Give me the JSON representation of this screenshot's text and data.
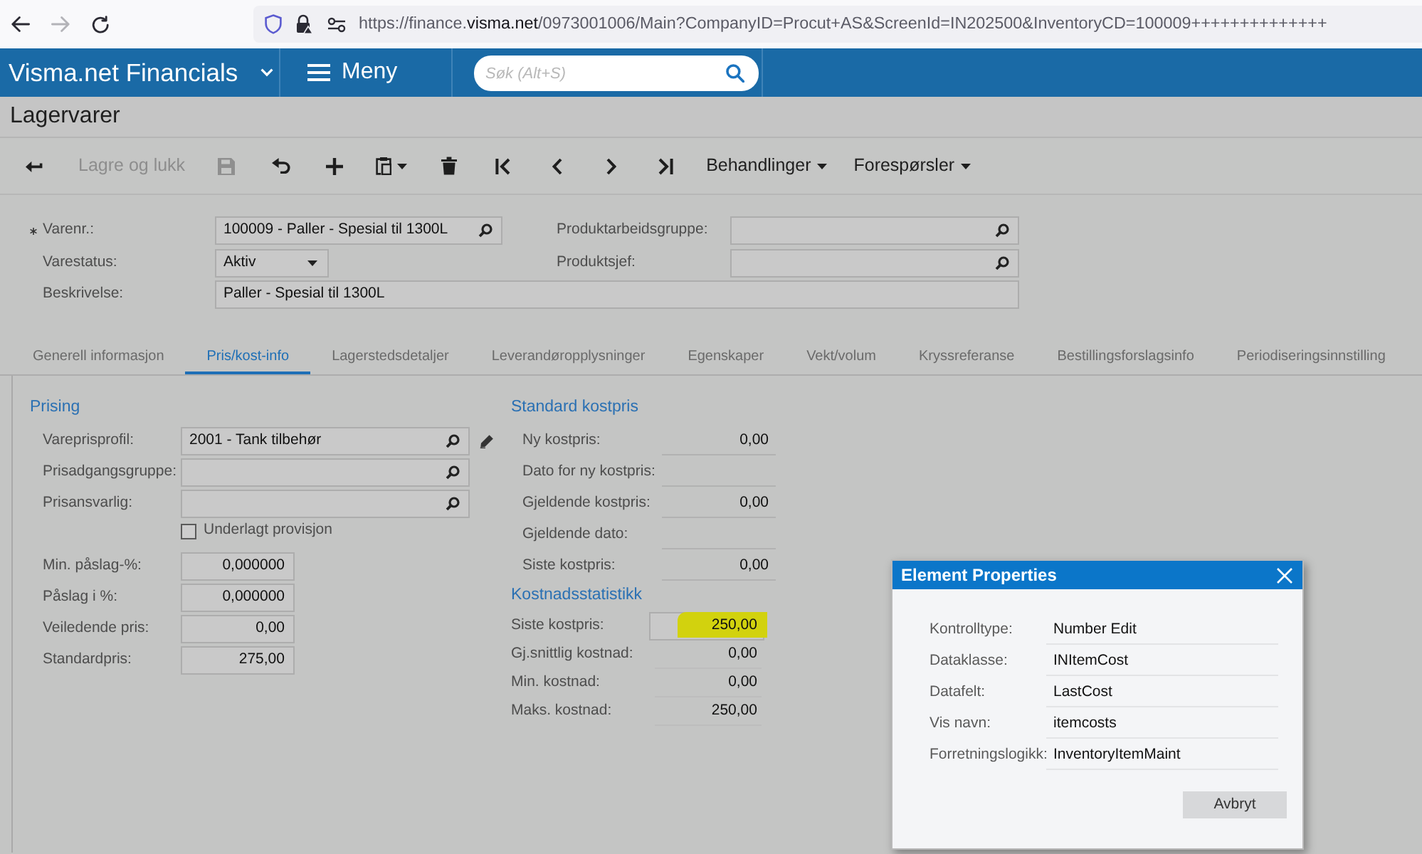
{
  "browser": {
    "nav": [
      {
        "kind": "back",
        "disabled": false
      },
      {
        "kind": "forward",
        "disabled": true
      },
      {
        "kind": "reload",
        "disabled": false
      }
    ],
    "url_prefix": "https://finance.",
    "url_domain": "visma.net",
    "url_rest": "/0973001006/Main?CompanyID=Procut+AS&ScreenId=IN202500&InventoryCD=100009++++++++++++++"
  },
  "app_header": {
    "product": "Visma.net Financials",
    "menu_label": "Meny",
    "search": {
      "placeholder": "Søk (Alt+S)"
    }
  },
  "page_title": "Lagervarer",
  "toolbar": [
    {
      "kind": "back",
      "disabled": false
    },
    {
      "kind": "text",
      "label": "Lagre og lukk",
      "disabled": true
    },
    {
      "kind": "save",
      "disabled": true
    },
    {
      "kind": "undo",
      "disabled": false
    },
    {
      "kind": "add",
      "disabled": false
    },
    {
      "kind": "paste",
      "disabled": false
    },
    {
      "kind": "delete",
      "disabled": false
    },
    {
      "kind": "first",
      "disabled": false
    },
    {
      "kind": "previous",
      "disabled": false
    },
    {
      "kind": "next",
      "disabled": false
    },
    {
      "kind": "last",
      "disabled": false
    },
    {
      "kind": "dropdown",
      "label": "Behandlinger",
      "disabled": false
    },
    {
      "kind": "dropdown",
      "label": "Forespørsler",
      "disabled": false
    }
  ],
  "item_form": {
    "fields": [
      {
        "kind": "lookup",
        "label": "Varenr.:",
        "value": "100009 - Paller - Spesial til 1300L",
        "required": true
      },
      {
        "kind": "lookup",
        "label": "Produktarbeidsgruppe:",
        "required": false
      },
      {
        "kind": "select",
        "label": "Varestatus:",
        "value": "Aktiv",
        "required": false
      },
      {
        "kind": "lookup",
        "label": "Produktsjef:",
        "required": false
      },
      {
        "kind": "text",
        "label": "Beskrivelse:",
        "value": "Paller - Spesial til 1300L",
        "required": false
      }
    ]
  },
  "tabs": [
    {
      "label": "Generell informasjon",
      "selected": false
    },
    {
      "label": "Pris/kost-info",
      "selected": true
    },
    {
      "label": "Lagerstedsdetaljer",
      "selected": false
    },
    {
      "label": "Leverandøropplysninger",
      "selected": false
    },
    {
      "label": "Egenskaper",
      "selected": false
    },
    {
      "label": "Vekt/volum",
      "selected": false
    },
    {
      "label": "Kryssreferanse",
      "selected": false
    },
    {
      "label": "Bestillingsforslagsinfo",
      "selected": false
    },
    {
      "label": "Periodiseringsinnstilling",
      "selected": false
    }
  ],
  "pricing": {
    "title": "Prising",
    "rows": [
      {
        "kind": "lookup",
        "label": "Vareprisprofil:",
        "value": "2001 - Tank tilbehør",
        "editable": true
      },
      {
        "kind": "lookup",
        "label": "Prisadgangsgruppe:",
        "editable": false
      },
      {
        "kind": "lookup",
        "label": "Prisansvarlig:",
        "editable": false
      },
      {
        "kind": "checkbox",
        "label": "Underlagt provisjon",
        "checked": false
      },
      {
        "kind": "number",
        "label": "Min. påslag-%:",
        "value": "0,000000"
      },
      {
        "kind": "number",
        "label": "Påslag i %:",
        "value": "0,000000"
      },
      {
        "kind": "number",
        "label": "Veiledende pris:",
        "value": "0,00"
      },
      {
        "kind": "number",
        "label": "Standardpris:",
        "value": "275,00"
      }
    ]
  },
  "standard_cost": {
    "title": "Standard kostpris",
    "rows": [
      {
        "label": "Ny kostpris:",
        "value": "0,00"
      },
      {
        "label": "Dato for ny kostpris:"
      },
      {
        "label": "Gjeldende kostpris:",
        "value": "0,00"
      },
      {
        "label": "Gjeldende dato:"
      },
      {
        "label": "Siste kostpris:",
        "value": "0,00"
      }
    ]
  },
  "cost_statistics": {
    "title": "Kostnadsstatistikk",
    "rows": [
      {
        "kind": "input",
        "label": "Siste kostpris:",
        "value": "250,00",
        "highlighted": true
      },
      {
        "kind": "readonly",
        "label": "Gj.snittlig kostnad:",
        "value": "0,00",
        "highlighted": false
      },
      {
        "kind": "readonly",
        "label": "Min. kostnad:",
        "value": "0,00",
        "highlighted": false
      },
      {
        "kind": "readonly",
        "label": "Maks. kostnad:",
        "value": "250,00",
        "highlighted": false
      }
    ]
  },
  "dialog": {
    "title": "Element Properties",
    "rows": [
      {
        "label": "Kontrolltype:",
        "value": "Number Edit"
      },
      {
        "label": "Dataklasse:",
        "value": "INItemCost"
      },
      {
        "label": "Datafelt:",
        "value": "LastCost"
      },
      {
        "label": "Vis navn:",
        "value": "itemcosts"
      },
      {
        "label": "Forretningslogikk:",
        "value": "InventoryItemMaint"
      }
    ],
    "buttons": [
      "Avbryt"
    ]
  }
}
